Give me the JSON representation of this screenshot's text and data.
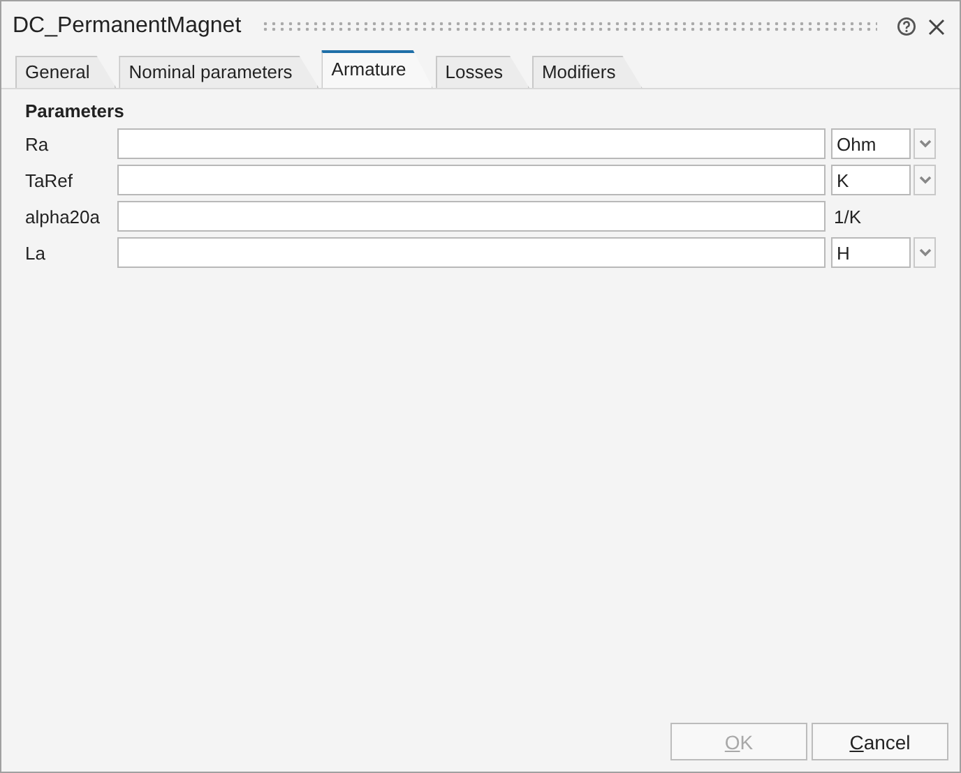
{
  "window": {
    "title": "DC_PermanentMagnet"
  },
  "tabs": [
    {
      "label": "General",
      "selected": false
    },
    {
      "label": "Nominal parameters",
      "selected": false
    },
    {
      "label": "Armature",
      "selected": true
    },
    {
      "label": "Losses",
      "selected": false
    },
    {
      "label": "Modifiers",
      "selected": false
    }
  ],
  "section": {
    "title": "Parameters"
  },
  "parameters": [
    {
      "name": "Ra",
      "kind": "select",
      "unit": "Ohm"
    },
    {
      "name": "TaRef",
      "kind": "select",
      "unit": "K"
    },
    {
      "name": "alpha20a",
      "kind": "text",
      "unit": "1/K"
    },
    {
      "name": "La",
      "kind": "select",
      "unit": "H"
    }
  ],
  "buttons": [
    {
      "label": "OK",
      "disabled": true
    },
    {
      "label": "Cancel",
      "disabled": false
    }
  ]
}
